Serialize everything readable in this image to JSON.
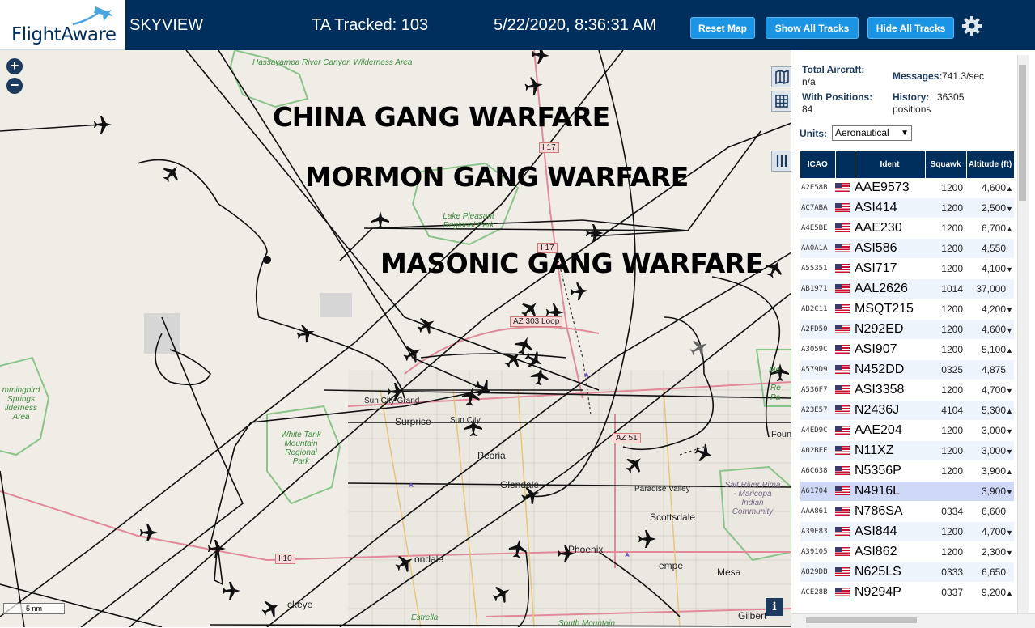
{
  "header": {
    "logo_text": "FlightAware",
    "title": "SKYVIEW",
    "tracked": "TA Tracked: 103",
    "datetime": "5/22/2020, 8:36:31 AM",
    "reset_label": "Reset Map",
    "show_label": "Show All Tracks",
    "hide_label": "Hide All Tracks"
  },
  "map": {
    "overlay_texts": [
      "CHINA GANG WARFARE",
      "MORMON GANG WARFARE",
      "MASONIC GANG WARFARE"
    ],
    "places": {
      "hassayampa": "Hassayampa River Canyon Wilderness Area",
      "lake_pleasant": "Lake Pleasant Regional Park",
      "hummingbird": "mmingbird Springs ilderness Area",
      "white_tank": "White Tank Mountain Regional Park",
      "salt_river": "Salt River Pima - Maricopa Indian Community",
      "mcdowell_a": "Me",
      "mcdowell_b": "Re",
      "mcdowell_c": "Pa",
      "fountain": "Foun",
      "sun_city_grand": "Sun City Grand",
      "surprise": "Surprise",
      "sun_city": "Sun City",
      "peoria": "Peoria",
      "glendale": "Glendale",
      "paradise_valley": "Paradise Valley",
      "scottsdale": "Scottsdale",
      "phoenix": "Phoenix",
      "avondale": "ondale",
      "tempe": "empe",
      "mesa": "Mesa",
      "buckeye": "ckeye",
      "gilbert": "Gilbert",
      "estrella": "Estrella",
      "south_mountain": "South Mountain"
    },
    "highways": {
      "i17_a": "I 17",
      "i17_b": "I 17",
      "az303": "AZ 303 Loop",
      "az51": "AZ 51",
      "i10": "I 10"
    },
    "scale_label": "5 nm",
    "info_label": "i"
  },
  "sidebar": {
    "total_label": "Total Aircraft:",
    "total_value": "n/a",
    "messages_label": "Messages:",
    "messages_value": "741.3/sec",
    "positions_label": "With Positions:",
    "positions_value": "84",
    "history_label": "History:",
    "history_value": "36305 positions",
    "units_label": "Units:",
    "units_value": "Aeronautical",
    "columns": [
      "ICAO",
      "",
      "Ident",
      "Squawk",
      "Altitude (ft)"
    ],
    "rows": [
      {
        "icao": "A2E58B",
        "ident": "AAE9573",
        "squawk": "1200",
        "alt": "4,600",
        "trend": "up"
      },
      {
        "icao": "AC7ABA",
        "ident": "ASI414",
        "squawk": "1200",
        "alt": "2,500",
        "trend": "down"
      },
      {
        "icao": "A4E5BE",
        "ident": "AAE230",
        "squawk": "1200",
        "alt": "6,700",
        "trend": "up"
      },
      {
        "icao": "AA0A1A",
        "ident": "ASI586",
        "squawk": "1200",
        "alt": "4,550",
        "trend": ""
      },
      {
        "icao": "A55351",
        "ident": "ASI717",
        "squawk": "1200",
        "alt": "4,100",
        "trend": "down"
      },
      {
        "icao": "AB1971",
        "ident": "AAL2626",
        "squawk": "1014",
        "alt": "37,000",
        "trend": ""
      },
      {
        "icao": "AB2C11",
        "ident": "MSQT215",
        "squawk": "1200",
        "alt": "4,200",
        "trend": "down"
      },
      {
        "icao": "A2FD50",
        "ident": "N292ED",
        "squawk": "1200",
        "alt": "4,600",
        "trend": "down"
      },
      {
        "icao": "A3059C",
        "ident": "ASI907",
        "squawk": "1200",
        "alt": "5,100",
        "trend": "up"
      },
      {
        "icao": "A579D9",
        "ident": "N452DD",
        "squawk": "0325",
        "alt": "4,875",
        "trend": ""
      },
      {
        "icao": "A536F7",
        "ident": "ASI3358",
        "squawk": "1200",
        "alt": "4,700",
        "trend": "down"
      },
      {
        "icao": "A23E57",
        "ident": "N2436J",
        "squawk": "4104",
        "alt": "5,300",
        "trend": "up"
      },
      {
        "icao": "A4ED9C",
        "ident": "AAE204",
        "squawk": "1200",
        "alt": "3,000",
        "trend": "down"
      },
      {
        "icao": "A02BFF",
        "ident": "N11XZ",
        "squawk": "1200",
        "alt": "3,000",
        "trend": "down"
      },
      {
        "icao": "A6C638",
        "ident": "N5356P",
        "squawk": "1200",
        "alt": "3,900",
        "trend": "up"
      },
      {
        "icao": "A61704",
        "ident": "N4916L",
        "squawk": "",
        "alt": "3,900",
        "trend": "down",
        "selected": true
      },
      {
        "icao": "AAA861",
        "ident": "N786SA",
        "squawk": "0334",
        "alt": "6,600",
        "trend": ""
      },
      {
        "icao": "A39E83",
        "ident": "ASI844",
        "squawk": "1200",
        "alt": "4,700",
        "trend": "down"
      },
      {
        "icao": "A39105",
        "ident": "ASI862",
        "squawk": "1200",
        "alt": "2,300",
        "trend": "down"
      },
      {
        "icao": "A829DB",
        "ident": "N625LS",
        "squawk": "0333",
        "alt": "6,650",
        "trend": ""
      },
      {
        "icao": "ACE28B",
        "ident": "N9294P",
        "squawk": "0337",
        "alt": "9,200",
        "trend": "up"
      }
    ]
  },
  "icons": [
    "plus-icon",
    "minus-icon",
    "map-icon",
    "grid-icon",
    "columns-icon",
    "gear-icon",
    "us-flag-icon",
    "aircraft-icon"
  ]
}
